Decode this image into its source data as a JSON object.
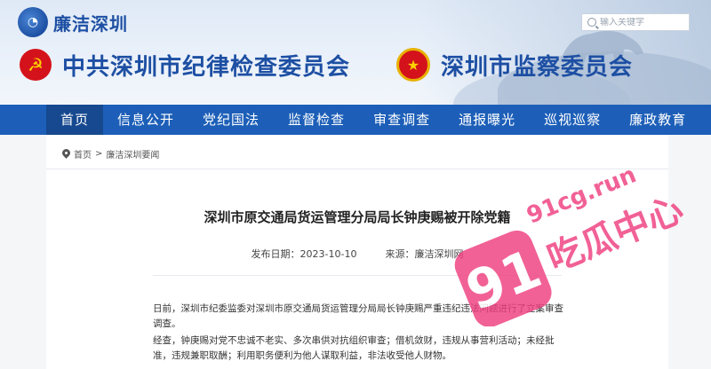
{
  "header": {
    "logo_text": "廉洁深圳",
    "search_placeholder": "输入关键字",
    "org_title": "中共深圳市纪律检查委员会",
    "org_title2": "深圳市监察委员会"
  },
  "nav": {
    "items": [
      "首页",
      "信息公开",
      "党纪国法",
      "监督检查",
      "审查调查",
      "通报曝光",
      "巡视巡察",
      "廉政教育"
    ]
  },
  "breadcrumb": {
    "home": "首页",
    "sep": ">",
    "section": "廉洁深圳要闻"
  },
  "article": {
    "title": "深圳市原交通局货运管理分局局长钟庚赐被开除党籍",
    "date_label": "发布日期：",
    "date": "2023-10-10",
    "source_label": "来源：",
    "source": "廉洁深圳网",
    "paragraph1": "日前，深圳市纪委监委对深圳市原交通局货运管理分局局长钟庚赐严重违纪违法问题进行了立案审查调查。",
    "paragraph2": "经查，钟庚赐对党不忠诚不老实、多次串供对抗组织审查；借机敛财，违规从事营利活动；未经批准，违规兼职取酬；利用职务便利为他人谋取利益，非法收受他人财物。"
  },
  "watermark": {
    "brand_number": "91",
    "domain": "91cg.run",
    "name": "吃瓜中心",
    "color": "#ef3f7f"
  },
  "colors": {
    "nav_bg": "#1d5fb8",
    "brand_blue": "#1d4fa3",
    "party_red": "#d4121b"
  }
}
